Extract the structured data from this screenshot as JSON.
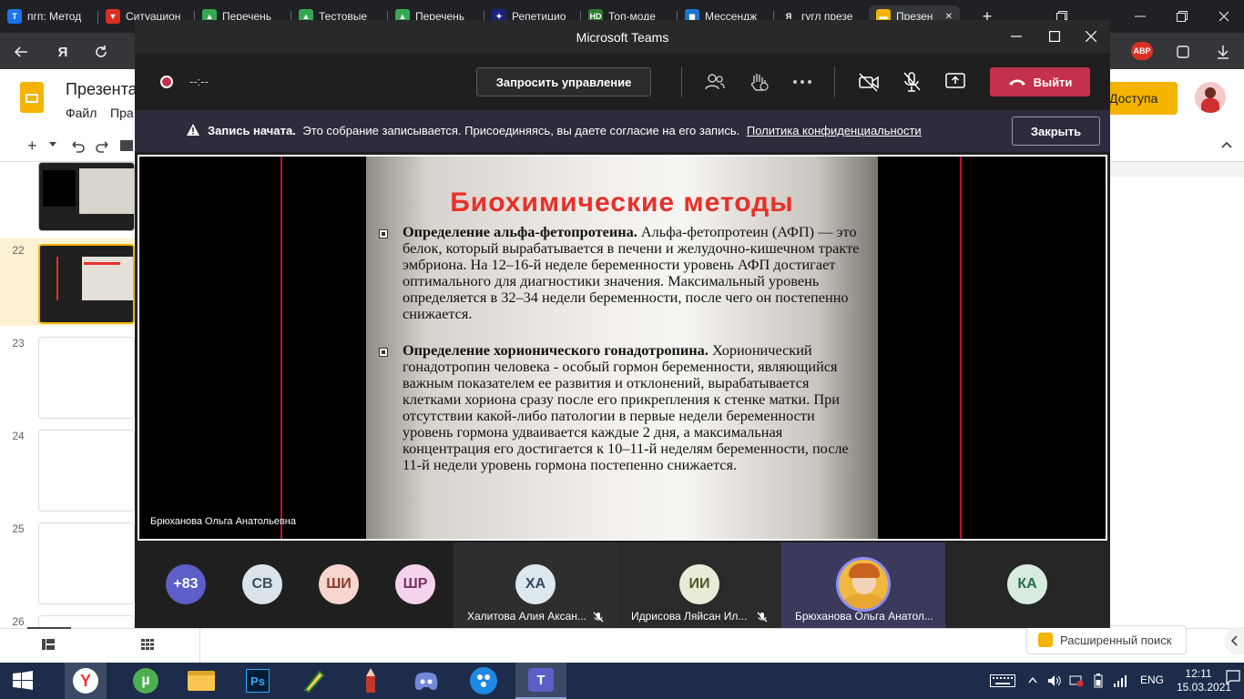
{
  "browser": {
    "tabs": [
      {
        "label": "пгп: Метод",
        "favicon": "T",
        "color": "#1a73e8"
      },
      {
        "label": "Ситуацион",
        "favicon": "▼",
        "color": "#d93025"
      },
      {
        "label": "Перечень",
        "favicon": "▲",
        "color": "#34a853"
      },
      {
        "label": "Тестовые",
        "favicon": "▲",
        "color": "#34a853"
      },
      {
        "label": "Перечень",
        "favicon": "▲",
        "color": "#34a853"
      },
      {
        "label": "Репетицио",
        "favicon": "✦",
        "color": "#1a237e"
      },
      {
        "label": "Топ-моде",
        "favicon": "HD",
        "color": "#2e7d32"
      },
      {
        "label": "Мессендж",
        "favicon": "◼",
        "color": "#1976d2"
      },
      {
        "label": "гугл презе",
        "favicon": "Я",
        "color": "#202124"
      },
      {
        "label": "Презен",
        "favicon": "▬",
        "color": "#f4b400"
      }
    ],
    "new_tab": "+",
    "url_icon": "Я",
    "extension_badge": "ABP"
  },
  "slides": {
    "doc_title": "Презента",
    "menu": [
      "Файл",
      "Пра"
    ],
    "share_label": "Доступа",
    "thumbnails": [
      "22",
      "23",
      "24",
      "25",
      "26"
    ],
    "search_label": "Расширенный поиск"
  },
  "teams": {
    "window_title": "Microsoft Teams",
    "timer": "--:--",
    "request_control": "Запросить управление",
    "leave": "Выйти",
    "banner": {
      "title": "Запись начата.",
      "text": "Это собрание записывается. Присоединяясь, вы даете согласие на его запись.",
      "link": "Политика конфиденциальности",
      "close": "Закрыть"
    },
    "presenter_name": "Брюханова Ольга Анатольевна",
    "participants": [
      {
        "initials": "+83",
        "bg": "#5b5fc7",
        "fg": "#ffffff"
      },
      {
        "initials": "СВ",
        "bg": "#dbe4ea",
        "fg": "#3d4f5c"
      },
      {
        "initials": "ШИ",
        "bg": "#f6d6cf",
        "fg": "#8c3a2a"
      },
      {
        "initials": "ШР",
        "bg": "#f3d4ec",
        "fg": "#7a2f66"
      },
      {
        "initials": "ХА",
        "bg": "#dde7ee",
        "fg": "#34495e",
        "name": "Халитова Алия Аксан..."
      },
      {
        "initials": "ИИ",
        "bg": "#e8ecd6",
        "fg": "#4d5a24",
        "name": "Идрисова Ляйсан Ил..."
      },
      {
        "initials": "",
        "bg": "#f0b940",
        "fg": "#ffffff",
        "name": "Брюханова Ольга Анатол..."
      },
      {
        "initials": "КА",
        "bg": "#d7ecdf",
        "fg": "#2d6a45"
      }
    ]
  },
  "slide": {
    "title": "Биохимические методы",
    "p1_bold": "Определение альфа-фетопротеина.",
    "p1_text": " Альфа-фетопротеин (АФП) — это белок, который вырабатывается в печени и желудочно-кишечном тракте эмбриона. На 12–16-й неделе беременности уровень АФП достигает оптимального для диагностики значения. Максимальный уровень определяется в 32–34 недели беременности, после чего он постепенно снижается.",
    "p2_bold": "Определение хорионического гонадотропина.",
    "p2_text": " Хорионический гонадотропин человека - особый гормон беременности, являющийся важным показателем ее развития и отклонений, вырабатывается клетками хориона сразу после его прикрепления к стенке матки. При отсутствии какой-либо патологии в первые недели беременности уровень гормона удваивается каждые 2 дня, а максимальная концентрация его достигается к 10–11-й неделям беременности, после 11-й недели уровень гормона постепенно снижается."
  },
  "taskbar": {
    "lang": "ENG",
    "time": "12:11",
    "date": "15.03.2021"
  }
}
